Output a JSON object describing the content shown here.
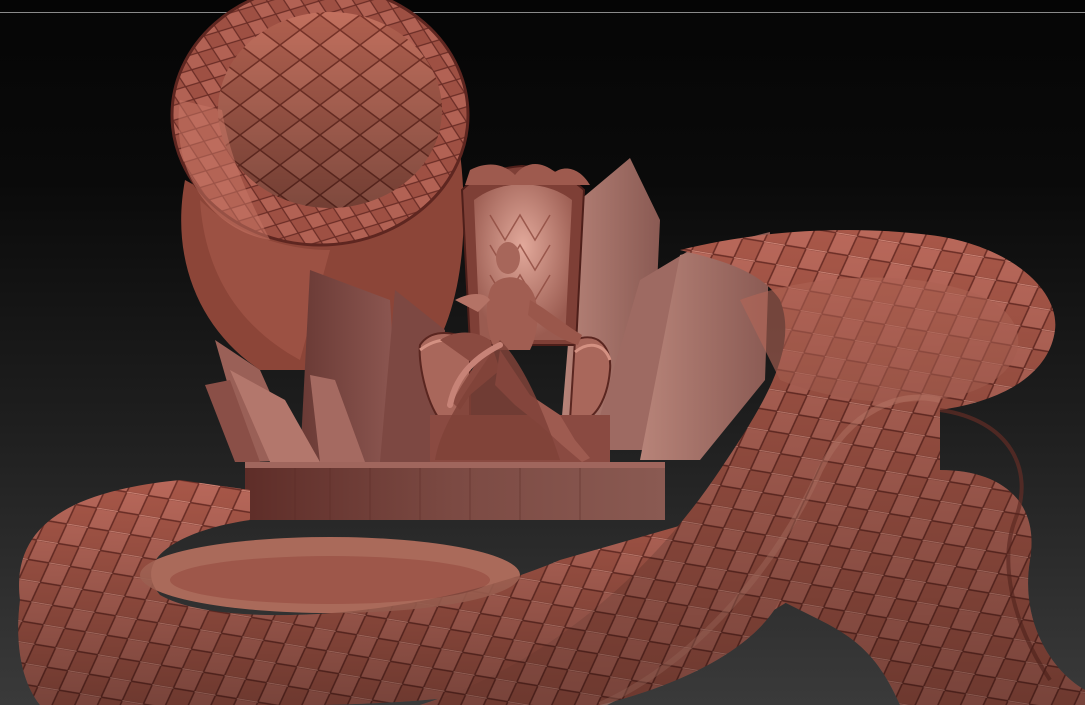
{
  "viewport": {
    "background": "#1a1a1a",
    "material_color": "#a95a4d",
    "material_highlight": "#d98a78",
    "material_shadow": "#4a1f1a"
  },
  "scene": {
    "objects": [
      "serpent-body",
      "crystal-cluster",
      "throne",
      "seated-figure",
      "stone-plinth"
    ]
  }
}
